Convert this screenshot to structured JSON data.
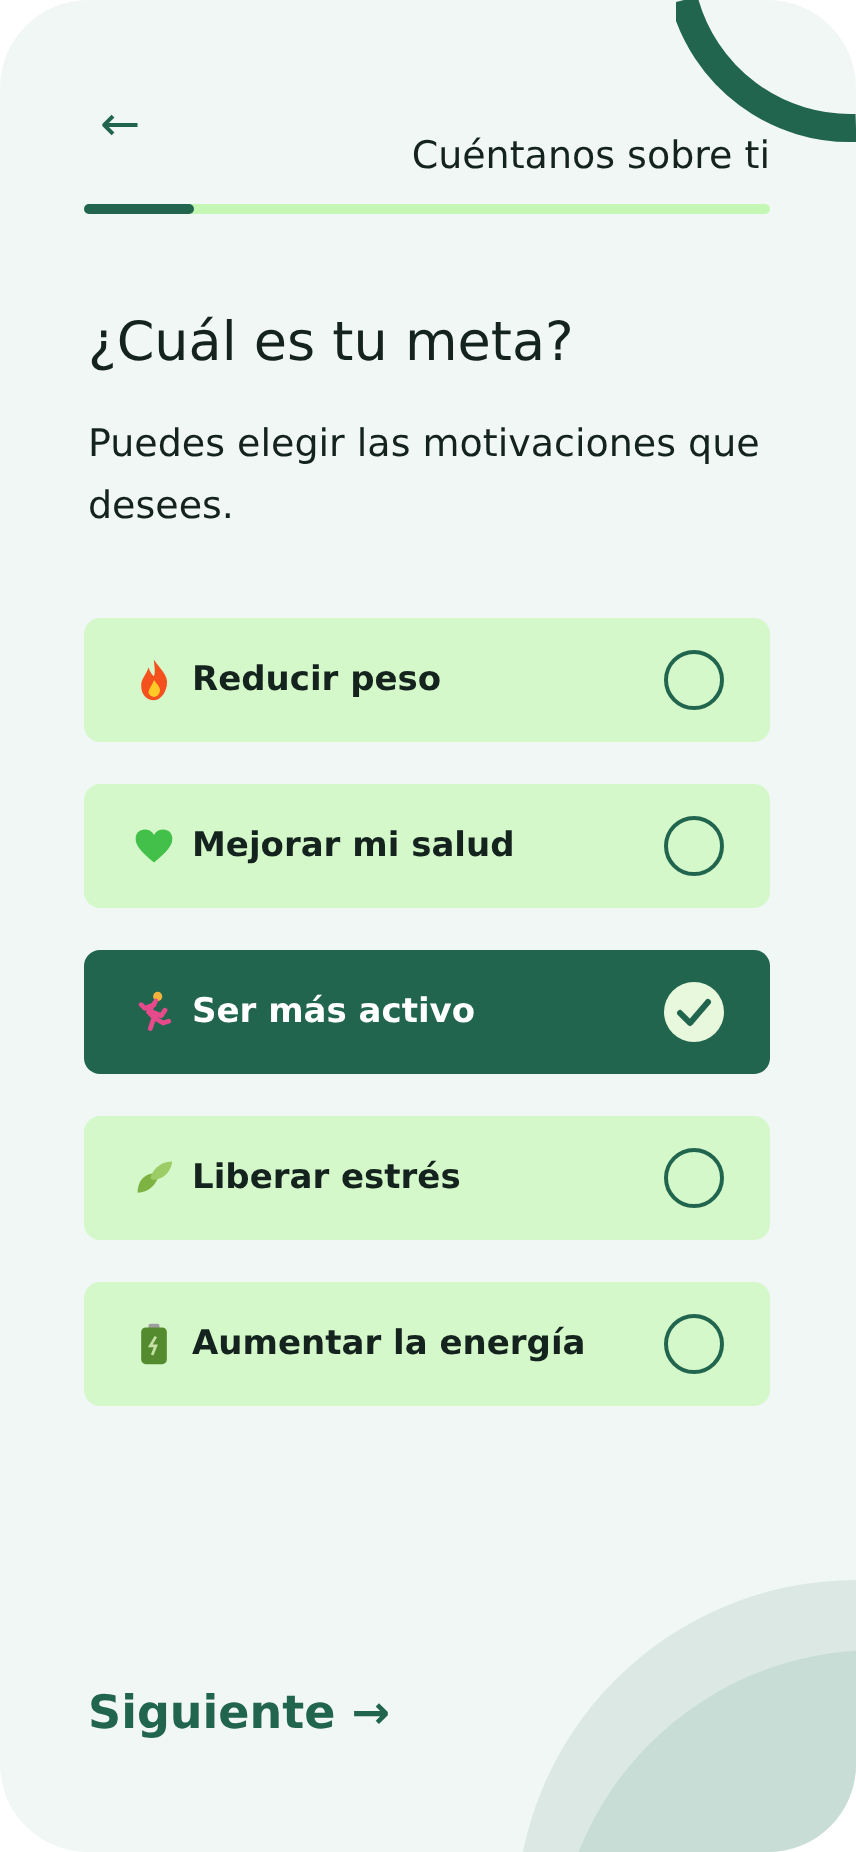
{
  "header": {
    "back_icon": "←",
    "title": "Cuéntanos sobre ti",
    "progress": {
      "level": 0.16
    }
  },
  "question": "¿Cuál es tu meta?",
  "subtitle": "Puedes elegir las motivaciones que desees.",
  "options": [
    {
      "label": "Reducir peso",
      "selected": false
    },
    {
      "label": "Mejorar mi salud",
      "selected": false
    },
    {
      "label": "Ser más activo",
      "selected": true
    },
    {
      "label": "Liberar estrés",
      "selected": false
    },
    {
      "label": "Aumentar la energía",
      "selected": false
    }
  ],
  "next_button": {
    "label": "Siguiente",
    "arrow": "→"
  }
}
